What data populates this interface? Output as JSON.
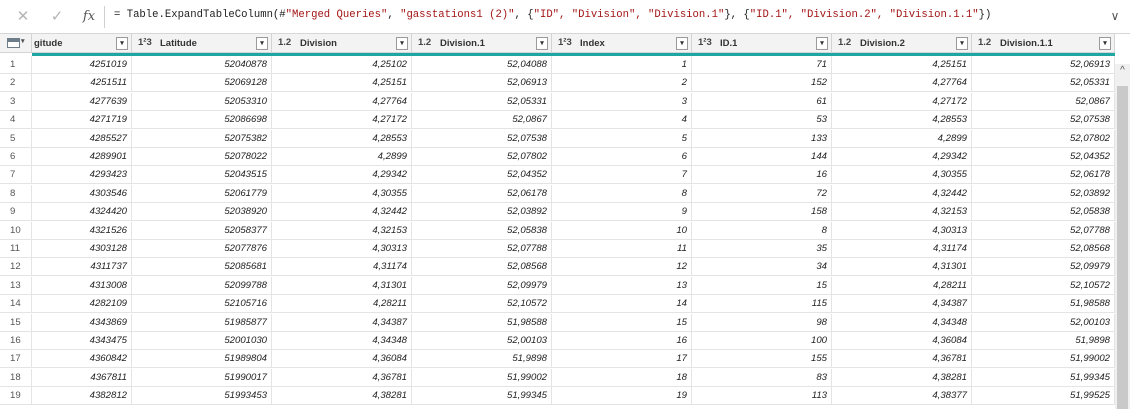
{
  "formula_bar": {
    "cancel_icon": "close-icon",
    "commit_icon": "check-icon",
    "fx_label": "fx",
    "formula_prefix": "= Table.ExpandTableColumn(#",
    "formula_arg1": "\"Merged Queries\"",
    "formula_mid1": ", ",
    "formula_arg2": "\"gasstations1 (2)\"",
    "formula_mid2": ", {",
    "formula_arg3": "\"ID\", \"Division\", \"Division.1\"",
    "formula_mid3": "}, {",
    "formula_arg4": "\"ID.1\", \"Division.2\", \"Division.1.1\"",
    "formula_suffix": "})"
  },
  "columns": [
    {
      "type": "",
      "name": "gitude"
    },
    {
      "type": "1²3",
      "name": "Latitude"
    },
    {
      "type": "1.2",
      "name": "Division"
    },
    {
      "type": "1.2",
      "name": "Division.1"
    },
    {
      "type": "1²3",
      "name": "Index"
    },
    {
      "type": "1²3",
      "name": "ID.1"
    },
    {
      "type": "1.2",
      "name": "Division.2"
    },
    {
      "type": "1.2",
      "name": "Division.1.1"
    }
  ],
  "rows": [
    [
      "1",
      "4251019",
      "52040878",
      "4,25102",
      "52,04088",
      "1",
      "71",
      "4,25151",
      "52,06913"
    ],
    [
      "2",
      "4251511",
      "52069128",
      "4,25151",
      "52,06913",
      "2",
      "152",
      "4,27764",
      "52,05331"
    ],
    [
      "3",
      "4277639",
      "52053310",
      "4,27764",
      "52,05331",
      "3",
      "61",
      "4,27172",
      "52,0867"
    ],
    [
      "4",
      "4271719",
      "52086698",
      "4,27172",
      "52,0867",
      "4",
      "53",
      "4,28553",
      "52,07538"
    ],
    [
      "5",
      "4285527",
      "52075382",
      "4,28553",
      "52,07538",
      "5",
      "133",
      "4,2899",
      "52,07802"
    ],
    [
      "6",
      "4289901",
      "52078022",
      "4,2899",
      "52,07802",
      "6",
      "144",
      "4,29342",
      "52,04352"
    ],
    [
      "7",
      "4293423",
      "52043515",
      "4,29342",
      "52,04352",
      "7",
      "16",
      "4,30355",
      "52,06178"
    ],
    [
      "8",
      "4303546",
      "52061779",
      "4,30355",
      "52,06178",
      "8",
      "72",
      "4,32442",
      "52,03892"
    ],
    [
      "9",
      "4324420",
      "52038920",
      "4,32442",
      "52,03892",
      "9",
      "158",
      "4,32153",
      "52,05838"
    ],
    [
      "10",
      "4321526",
      "52058377",
      "4,32153",
      "52,05838",
      "10",
      "8",
      "4,30313",
      "52,07788"
    ],
    [
      "11",
      "4303128",
      "52077876",
      "4,30313",
      "52,07788",
      "11",
      "35",
      "4,31174",
      "52,08568"
    ],
    [
      "12",
      "4311737",
      "52085681",
      "4,31174",
      "52,08568",
      "12",
      "34",
      "4,31301",
      "52,09979"
    ],
    [
      "13",
      "4313008",
      "52099788",
      "4,31301",
      "52,09979",
      "13",
      "15",
      "4,28211",
      "52,10572"
    ],
    [
      "14",
      "4282109",
      "52105716",
      "4,28211",
      "52,10572",
      "14",
      "115",
      "4,34387",
      "51,98588"
    ],
    [
      "15",
      "4343869",
      "51985877",
      "4,34387",
      "51,98588",
      "15",
      "98",
      "4,34348",
      "52,00103"
    ],
    [
      "16",
      "4343475",
      "52001030",
      "4,34348",
      "52,00103",
      "16",
      "100",
      "4,36084",
      "51,9898"
    ],
    [
      "17",
      "4360842",
      "51989804",
      "4,36084",
      "51,9898",
      "17",
      "155",
      "4,36781",
      "51,99002"
    ],
    [
      "18",
      "4367811",
      "51990017",
      "4,36781",
      "51,99002",
      "18",
      "83",
      "4,38281",
      "51,99345"
    ],
    [
      "19",
      "4382812",
      "51993453",
      "4,38281",
      "51,99345",
      "19",
      "113",
      "4,38377",
      "51,99525"
    ]
  ],
  "colors": {
    "accent": "#1ea7a2",
    "header_bg": "#f3f3f3",
    "string_literal": "#a31515"
  }
}
